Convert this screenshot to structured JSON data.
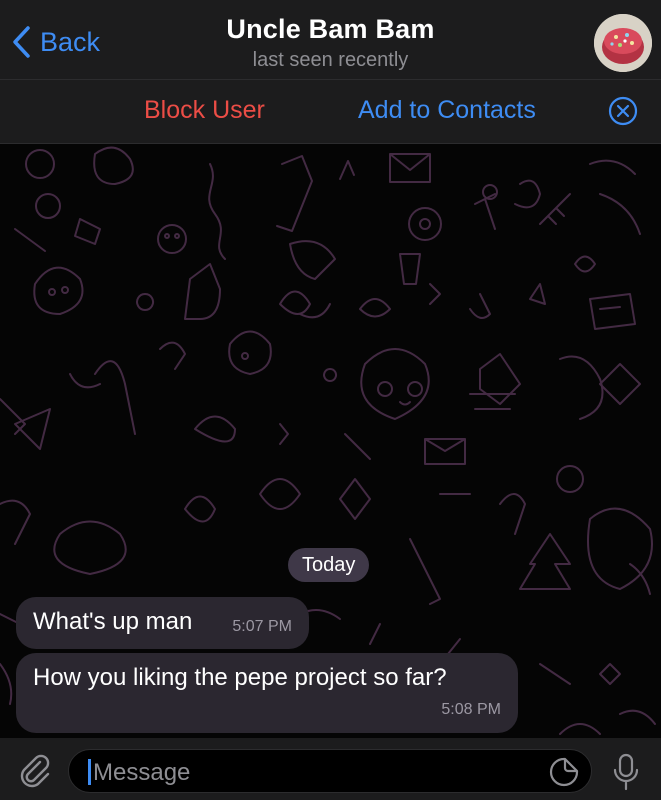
{
  "header": {
    "back_label": "Back",
    "title": "Uncle Bam Bam",
    "subtitle": "last seen recently"
  },
  "actions": {
    "block_label": "Block User",
    "add_label": "Add to Contacts"
  },
  "chat": {
    "date_label": "Today",
    "messages": [
      {
        "text": "What's up man",
        "time": "5:07 PM"
      },
      {
        "text": "How you liking the pepe project so far?",
        "time": "5:08 PM"
      }
    ]
  },
  "input": {
    "placeholder": "Message"
  },
  "colors": {
    "accent": "#3e8cf3",
    "danger": "#eb4d46",
    "bubble": "#2b2730",
    "bar": "#1c1c1d"
  },
  "icons": [
    "chevron-left-icon",
    "avatar-image",
    "close-circle-icon",
    "paperclip-icon",
    "sticker-icon",
    "microphone-icon"
  ]
}
